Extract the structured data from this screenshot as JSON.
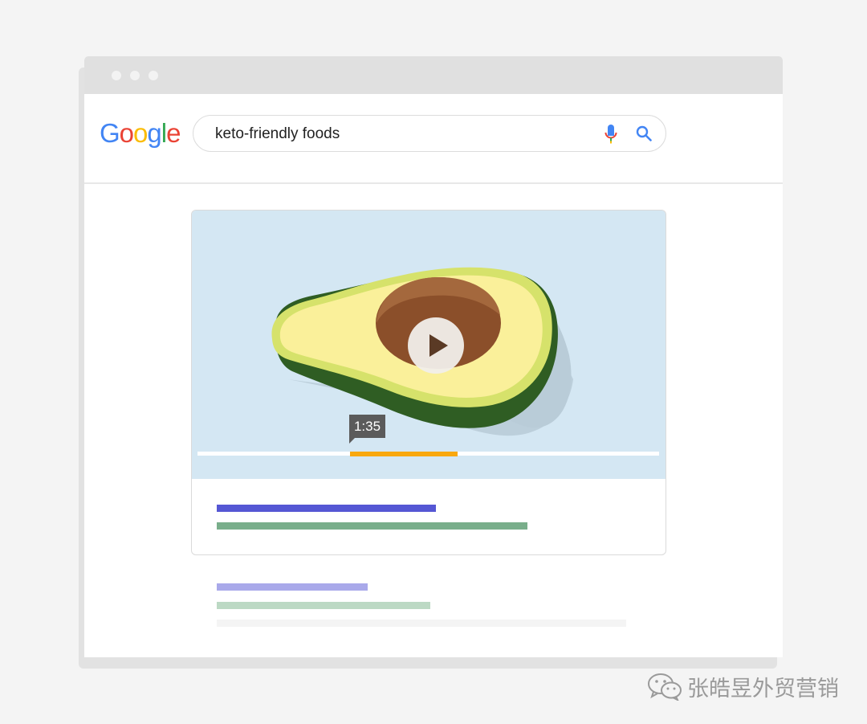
{
  "browser": {
    "window_dots": 3
  },
  "header": {
    "logo_letters": [
      {
        "char": "G",
        "color": "#4285F4"
      },
      {
        "char": "o",
        "color": "#EA4335"
      },
      {
        "char": "o",
        "color": "#FBBC05"
      },
      {
        "char": "g",
        "color": "#4285F4"
      },
      {
        "char": "l",
        "color": "#34A853"
      },
      {
        "char": "e",
        "color": "#EA4335"
      }
    ],
    "search": {
      "query": "keto-friendly foods",
      "mic_icon": "microphone-icon",
      "search_icon": "magnifier-icon"
    }
  },
  "video_result": {
    "thumbnail": "avocado-illustration",
    "play_icon": "play-icon",
    "timestamp": "1:35",
    "key_moment_colors": {
      "track": "#ffffff",
      "segment": "#f9a80e"
    }
  },
  "colors": {
    "page_background": "#f4f4f4",
    "video_background": "#d4e7f3",
    "title_line": "#5557d4",
    "url_line": "#79ae8b"
  },
  "watermark": {
    "icon": "wechat-icon",
    "text": "张皓昱外贸营销"
  }
}
